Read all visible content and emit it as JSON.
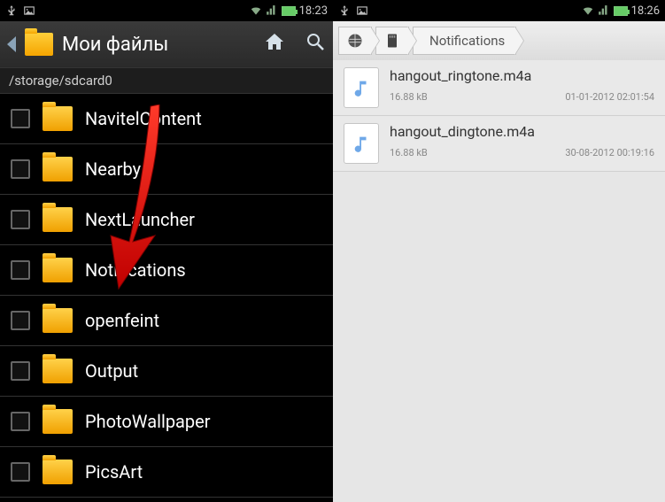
{
  "left": {
    "status": {
      "time": "18:23"
    },
    "title": "Мои файлы",
    "path": "/storage/sdcard0",
    "folders": [
      {
        "name": "NavitelContent"
      },
      {
        "name": "Nearby"
      },
      {
        "name": "NextLauncher"
      },
      {
        "name": "Notifications"
      },
      {
        "name": "openfeint"
      },
      {
        "name": "Output"
      },
      {
        "name": "PhotoWallpaper"
      },
      {
        "name": "PicsArt"
      }
    ]
  },
  "right": {
    "status": {
      "time": "18:26"
    },
    "breadcrumb": "Notifications",
    "files": [
      {
        "name": "hangout_ringtone.m4a",
        "size": "16.88 kB",
        "date": "01-01-2012 02:01:54"
      },
      {
        "name": "hangout_dingtone.m4a",
        "size": "16.88 kB",
        "date": "30-08-2012 00:19:16"
      }
    ]
  }
}
